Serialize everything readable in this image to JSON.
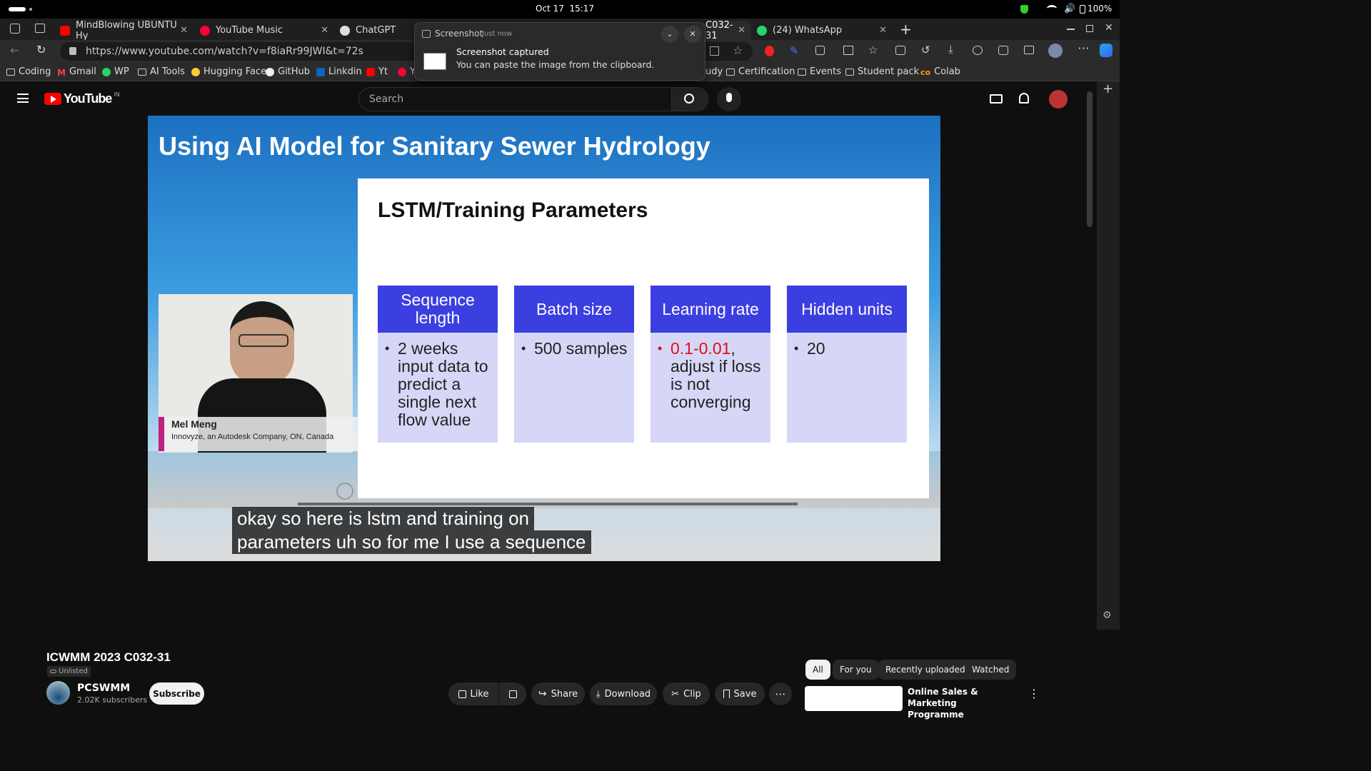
{
  "system": {
    "datetime": "Oct 17  15:17",
    "battery": "100%"
  },
  "tabs": [
    {
      "title": "MindBlowing UBUNTU Hy",
      "color": "#ff0000"
    },
    {
      "title": "YouTube Music",
      "color": "#ff0033"
    },
    {
      "title": "ChatGPT",
      "color": "#ffffff"
    },
    {
      "title": "C032-31",
      "color": "#ff0000"
    },
    {
      "title": "(24) WhatsApp",
      "color": "#25d366"
    }
  ],
  "address": {
    "url": "https://www.youtube.com/watch?v=f8iaRr99JWI&t=72s"
  },
  "bookmarks": [
    "Coding",
    "Gmail",
    "WP",
    "AI Tools",
    "Hugging Face",
    "GitHub",
    "Linkdin",
    "Yt",
    "Y",
    "udy",
    "Certification",
    "Events",
    "Student pack",
    "Colab"
  ],
  "notification": {
    "app": "Screenshot",
    "time": "Just now",
    "title": "Screenshot captured",
    "body": "You can paste the image from the clipboard."
  },
  "youtube": {
    "logo": "YouTube",
    "region": "IN",
    "search_placeholder": "Search"
  },
  "video": {
    "slide_title": "Using AI Model for Sanitary Sewer Hydrology",
    "panel_title": "LSTM/Training Parameters",
    "columns": [
      {
        "header": "Sequence length",
        "body": "2 weeks input data to predict a single next flow value"
      },
      {
        "header": "Batch size",
        "body": "500 samples"
      },
      {
        "header": "Learning rate",
        "body_red": "0.1-0.01",
        "body": ", adjust if loss is not converging"
      },
      {
        "header": "Hidden units",
        "body": "20"
      }
    ],
    "speaker_name": "Mel Meng",
    "speaker_org": "Innovyze, an Autodesk Company, ON, Canada",
    "caption_line1": "okay so here is lstm and training on",
    "caption_line2": "parameters uh so for me I use a sequence"
  },
  "details": {
    "title": "ICWMM 2023 C032-31",
    "visibility": "Unlisted",
    "channel": "PCSWMM",
    "subscribers": "2.02K subscribers",
    "subscribe": "Subscribe",
    "actions": {
      "like": "Like",
      "share": "Share",
      "download": "Download",
      "clip": "Clip",
      "save": "Save"
    }
  },
  "chips": [
    "All",
    "For you",
    "Recently uploaded",
    "Watched"
  ],
  "recommended": {
    "title": "Online Sales & Marketing Programme"
  }
}
